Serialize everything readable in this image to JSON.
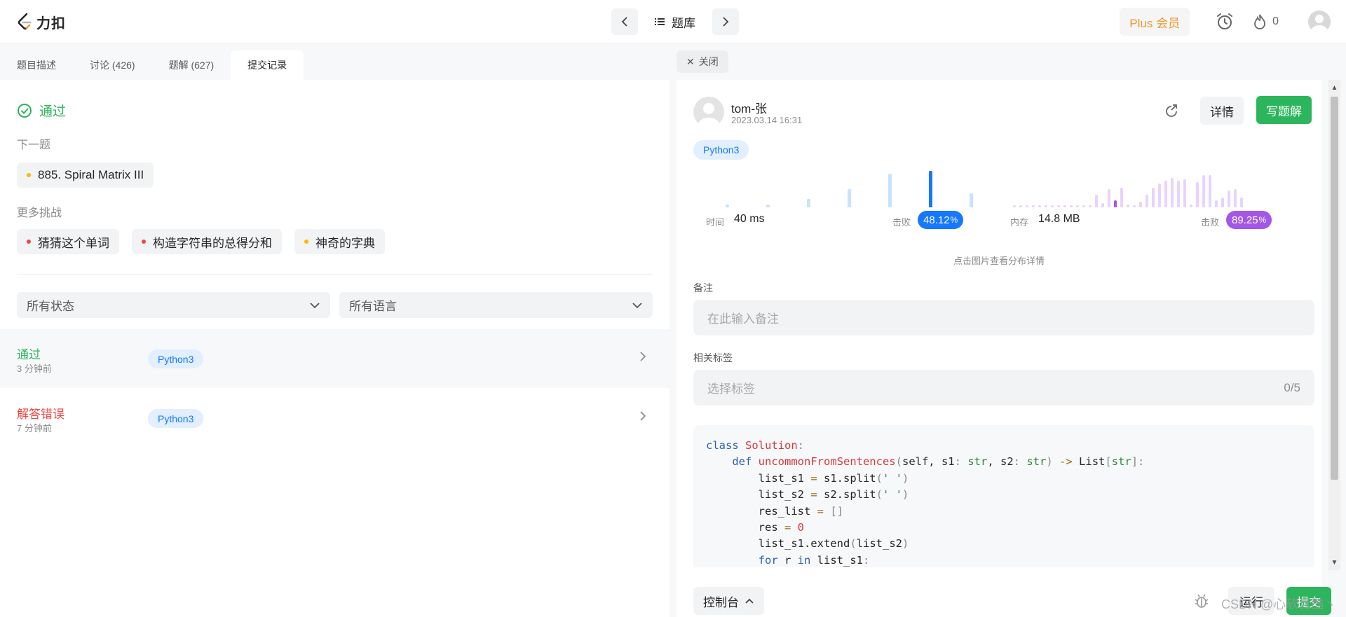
{
  "header": {
    "logo_text": "力扣",
    "bank_label": "题库",
    "plus_label": "Plus 会员",
    "fire_count": "0"
  },
  "tabs": [
    {
      "label": "题目描述"
    },
    {
      "label": "讨论 (426)"
    },
    {
      "label": "题解 (627)"
    },
    {
      "label": "提交记录"
    }
  ],
  "left": {
    "status": "通过",
    "next_label": "下一题",
    "next_problem": "885. Spiral Matrix III",
    "more_label": "更多挑战",
    "challenges": [
      {
        "label": "猜猜这个单词",
        "color": "#ef4743"
      },
      {
        "label": "构造字符串的总得分和",
        "color": "#ef4743"
      },
      {
        "label": "神奇的字典",
        "color": "#ffb800"
      }
    ],
    "filter_status": "所有状态",
    "filter_language": "所有语言",
    "submissions": [
      {
        "status": "通过",
        "status_color": "#2db55d",
        "time": "3 分钟前",
        "lang": "Python3"
      },
      {
        "status": "解答错误",
        "status_color": "#ef4743",
        "time": "7 分钟前",
        "lang": "Python3"
      }
    ]
  },
  "right": {
    "close_label": "关闭",
    "user_name": "tom-张",
    "date": "2023.03.14 16:31",
    "detail_label": "详情",
    "write_label": "写题解",
    "language": "Python3",
    "runtime": {
      "label": "时间",
      "value": "40 ms",
      "beat_label": "击败",
      "beat": "48.12",
      "unit": "%"
    },
    "memory": {
      "label": "内存",
      "value": "14.8 MB",
      "beat_label": "击败",
      "beat": "89.25",
      "unit": "%"
    },
    "hint": "点击图片查看分布详情",
    "note_label": "备注",
    "note_placeholder": "在此输入备注",
    "tags_label": "相关标签",
    "tags_placeholder": "选择标签",
    "tags_count": "0/5",
    "console_label": "控制台",
    "run_label": "运行",
    "submit_label": "提交"
  },
  "watermark": "CSDN @心软且酷丶",
  "colors": {
    "accent_green": "#2db55d",
    "blue": "#1677ff",
    "purple": "#a457e6",
    "error_red": "#ef4743"
  }
}
